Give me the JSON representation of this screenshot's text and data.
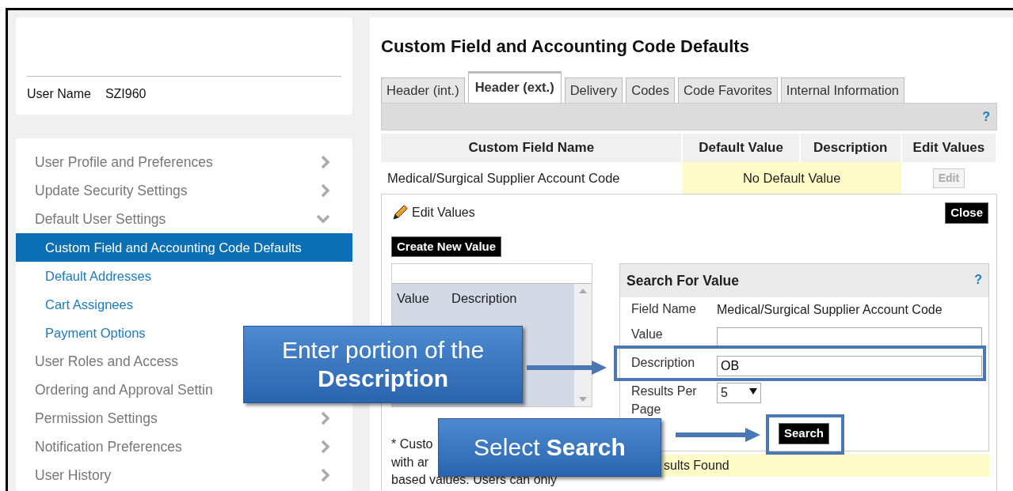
{
  "user_card": {
    "label": "User Name",
    "value": "SZI960"
  },
  "nav": [
    {
      "label": "User Profile and Preferences",
      "expanded": false
    },
    {
      "label": "Update Security Settings",
      "expanded": false
    },
    {
      "label": "Default User Settings",
      "expanded": true,
      "children": [
        {
          "label": "Custom Field and Accounting Code Defaults",
          "selected": true
        },
        {
          "label": "Default Addresses",
          "selected": false
        },
        {
          "label": "Cart Assignees",
          "selected": false
        },
        {
          "label": "Payment Options",
          "selected": false
        }
      ]
    },
    {
      "label": "User Roles and Access"
    },
    {
      "label": "Ordering and Approval Settin"
    },
    {
      "label": "Permission Settings",
      "expanded": false
    },
    {
      "label": "Notification Preferences",
      "expanded": false
    },
    {
      "label": "User History",
      "expanded": false
    }
  ],
  "page_title": "Custom Field and Accounting Code Defaults",
  "tabs": [
    {
      "label": "Header (int.)",
      "selected": false
    },
    {
      "label": "Header (ext.)",
      "selected": true
    },
    {
      "label": "Delivery",
      "selected": false
    },
    {
      "label": "Codes",
      "selected": false
    },
    {
      "label": "Code Favorites",
      "selected": false
    },
    {
      "label": "Internal Information",
      "selected": false
    }
  ],
  "toolbar_help": "?",
  "table": {
    "columns": [
      "Custom Field Name",
      "Default Value",
      "Description",
      "Edit Values"
    ],
    "rows": [
      {
        "name": "Medical/Surgical Supplier Account Code",
        "default_value": "No Default Value",
        "edit_button": "Edit",
        "edit_disabled": true
      }
    ]
  },
  "edit_panel": {
    "title": "Edit Values",
    "close": "Close",
    "create": "Create New Value",
    "list_columns": [
      "Value",
      "Description"
    ],
    "search": {
      "title": "Search For Value",
      "help": "?",
      "fields": [
        {
          "kind": "text",
          "label": "Field Name",
          "value": "Medical/Surgical Supplier Account Code"
        },
        {
          "kind": "input",
          "label": "Value"
        },
        {
          "kind": "input",
          "label": "Description",
          "value": "OB"
        },
        {
          "kind": "select",
          "label": "Results Per Page",
          "value": "5"
        }
      ],
      "button": "Search"
    },
    "message": "sults Found",
    "note_lines": [
      "* Custo",
      "with ar",
      "based values. Users can only"
    ]
  },
  "callouts": [
    {
      "text": "Enter portion of the **Description**"
    },
    {
      "text": "Select **Search**"
    }
  ]
}
